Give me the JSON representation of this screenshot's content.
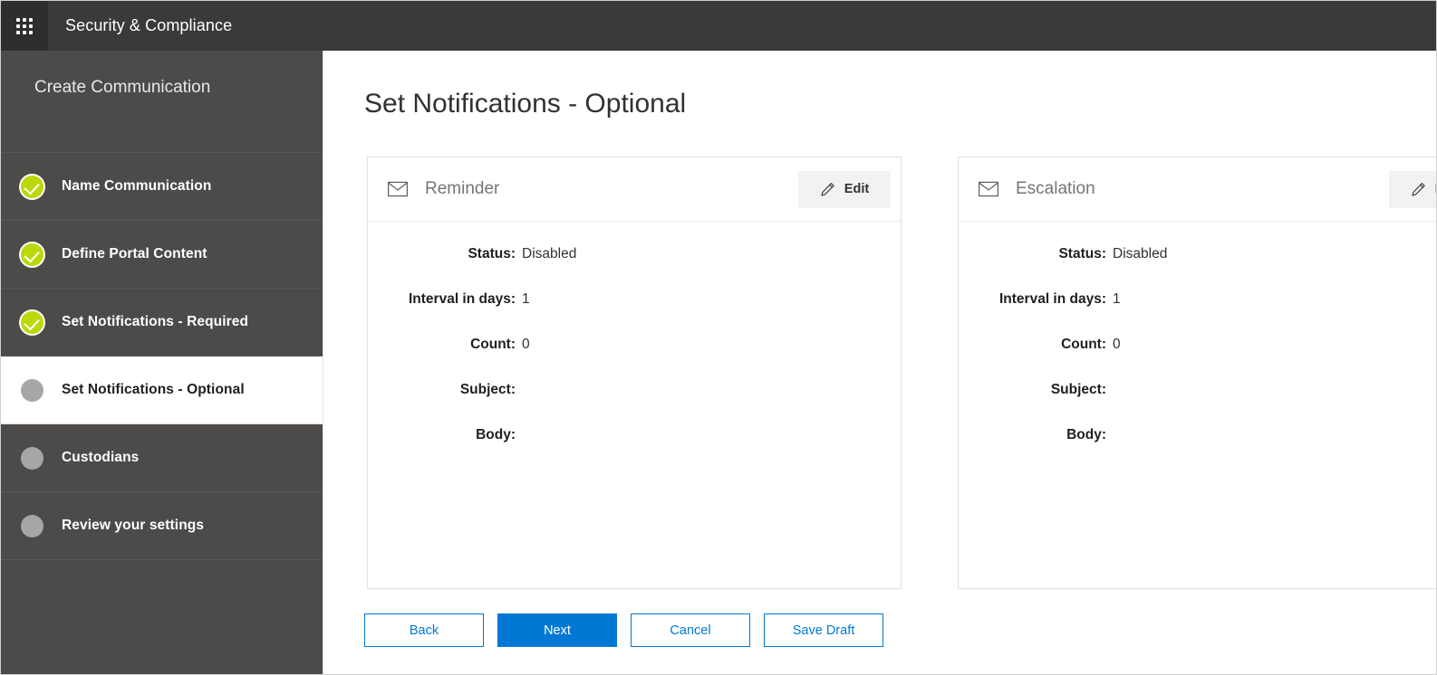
{
  "suite": {
    "waffle_icon": "app-launcher-waffle-icon",
    "title": "Security & Compliance"
  },
  "wizard": {
    "heading": "Create Communication",
    "steps": [
      {
        "label": "Name Communication",
        "state": "completed"
      },
      {
        "label": "Define Portal Content",
        "state": "completed"
      },
      {
        "label": "Set Notifications - Required",
        "state": "completed"
      },
      {
        "label": "Set Notifications - Optional",
        "state": "active"
      },
      {
        "label": "Custodians",
        "state": "pending"
      },
      {
        "label": "Review your settings",
        "state": "pending"
      }
    ]
  },
  "main": {
    "page_title": "Set Notifications - Optional",
    "cards": [
      {
        "icon": "envelope-icon",
        "title": "Reminder",
        "edit_label": "Edit",
        "edit_icon": "pencil-icon",
        "fields": [
          {
            "label": "Status:",
            "value": "Disabled"
          },
          {
            "label": "Interval in days:",
            "value": "1"
          },
          {
            "label": "Count:",
            "value": "0"
          },
          {
            "label": "Subject:",
            "value": ""
          },
          {
            "label": "Body:",
            "value": ""
          }
        ]
      },
      {
        "icon": "envelope-icon",
        "title": "Escalation",
        "edit_label": "Edit",
        "edit_icon": "pencil-icon",
        "fields": [
          {
            "label": "Status:",
            "value": "Disabled"
          },
          {
            "label": "Interval in days:",
            "value": "1"
          },
          {
            "label": "Count:",
            "value": "0"
          },
          {
            "label": "Subject:",
            "value": ""
          },
          {
            "label": "Body:",
            "value": ""
          }
        ]
      }
    ],
    "actions": [
      {
        "label": "Back",
        "style": "secondary"
      },
      {
        "label": "Next",
        "style": "primary"
      },
      {
        "label": "Cancel",
        "style": "secondary"
      },
      {
        "label": "Save Draft",
        "style": "secondary"
      }
    ]
  },
  "colors": {
    "suite_bar": "#3b3a39",
    "rail": "#4d4b49",
    "accent_blue": "#0078d4",
    "completed_green": "#bad80a",
    "pending_gray": "#a6a6a6"
  }
}
